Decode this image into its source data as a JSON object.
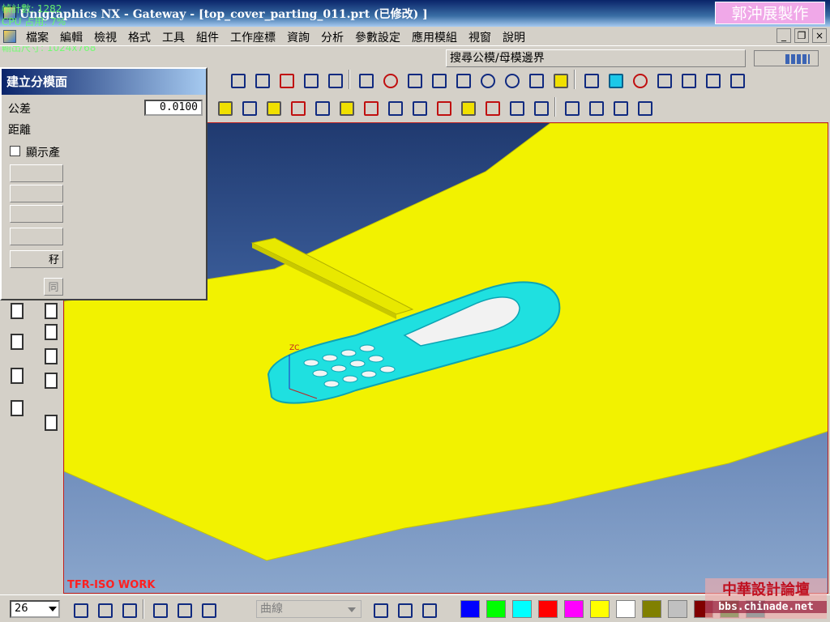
{
  "window": {
    "title": "Unigraphics NX - Gateway - [top_cover_parting_011.prt (已修改) ]",
    "watermark": "郭沖展製作"
  },
  "overlay": {
    "line1": "幀計數: 1282",
    "line2": "CPU 占用: 7%",
    "line3": "輸入尺寸: 1024x768",
    "line4": "輸出尺寸: 1024x768"
  },
  "menu": [
    "檔案",
    "編輯",
    "檢視",
    "格式",
    "工具",
    "組件",
    "工作座標",
    "資詢",
    "分析",
    "參數設定",
    "應用模組",
    "視窗",
    "說明"
  ],
  "window_controls": [
    "_",
    "❐",
    "×"
  ],
  "toolbar": {
    "selection_label": "搜尋公模/母模邊界"
  },
  "dialog": {
    "title": "建立分模面",
    "tolerance_label": "公差",
    "tolerance_value": "0.0100",
    "distance_label": "距離",
    "show_product_label": "顯示產",
    "ok_button": "秄",
    "cancel_button": "同"
  },
  "viewport": {
    "wcs_label": "TFR-ISO WORK",
    "axis_label": "ZC"
  },
  "bottombar": {
    "layer_value": "26",
    "curve_select": "曲線",
    "palette": [
      "#0000ff",
      "#00ff00",
      "#00ffff",
      "#ff0000",
      "#ff00ff",
      "#ffff00",
      "#ffffff",
      "#808000",
      "#c0c0c0",
      "#800000",
      "#008000",
      "#008080"
    ]
  },
  "corner_watermark": {
    "line1": "中華設計論壇",
    "line2": "bbs.chinade.net"
  }
}
